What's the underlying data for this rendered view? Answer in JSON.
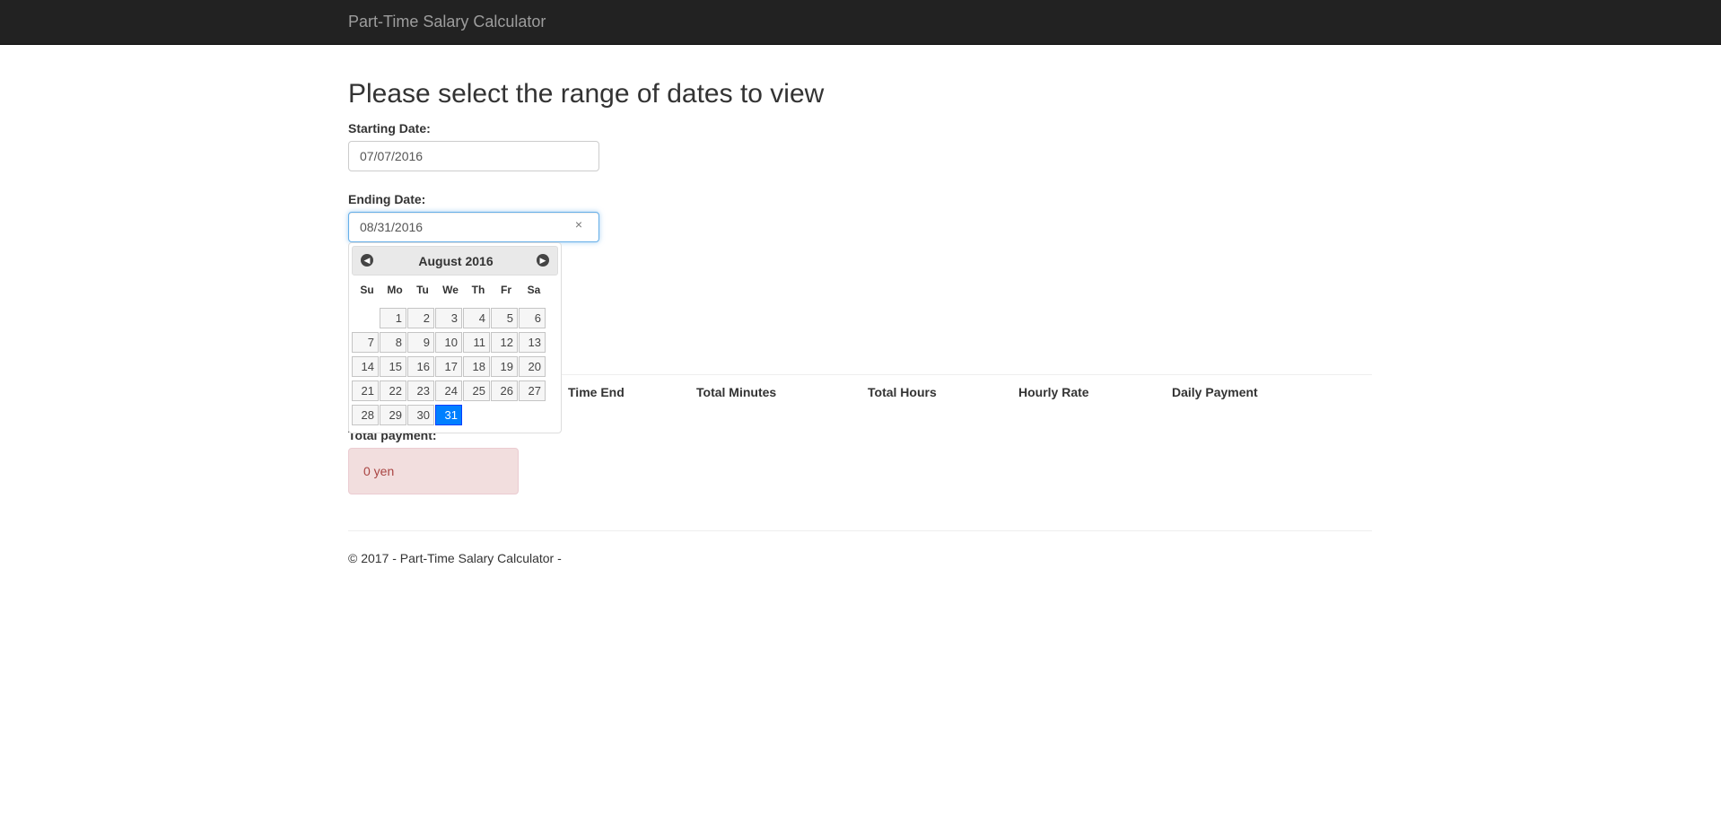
{
  "navbar": {
    "brand": "Part-Time Salary Calculator"
  },
  "main": {
    "title": "Please select the range of dates to view",
    "start": {
      "label": "Starting Date:",
      "value": "07/07/2016"
    },
    "end": {
      "label": "Ending Date:",
      "value": "08/31/2016",
      "clear_icon": "×"
    },
    "table_headers": [
      "Time End",
      "Total Minutes",
      "Total Hours",
      "Hourly Rate",
      "Daily Payment"
    ],
    "total_label": "Total payment:",
    "total_value": "0 yen"
  },
  "datepicker": {
    "month_label": "August 2016",
    "prev_icon": "◀",
    "next_icon": "▶",
    "weekdays": [
      "Su",
      "Mo",
      "Tu",
      "We",
      "Th",
      "Fr",
      "Sa"
    ],
    "days": [
      [
        "",
        "1",
        "2",
        "3",
        "4",
        "5",
        "6"
      ],
      [
        "7",
        "8",
        "9",
        "10",
        "11",
        "12",
        "13"
      ],
      [
        "14",
        "15",
        "16",
        "17",
        "18",
        "19",
        "20"
      ],
      [
        "21",
        "22",
        "23",
        "24",
        "25",
        "26",
        "27"
      ],
      [
        "28",
        "29",
        "30",
        "31",
        "",
        "",
        ""
      ]
    ],
    "selected": "31",
    "colors": {
      "selected_bg": "#007fff",
      "selected_border": "#003eff"
    }
  },
  "footer": {
    "text": "© 2017 - Part-Time Salary Calculator -"
  }
}
